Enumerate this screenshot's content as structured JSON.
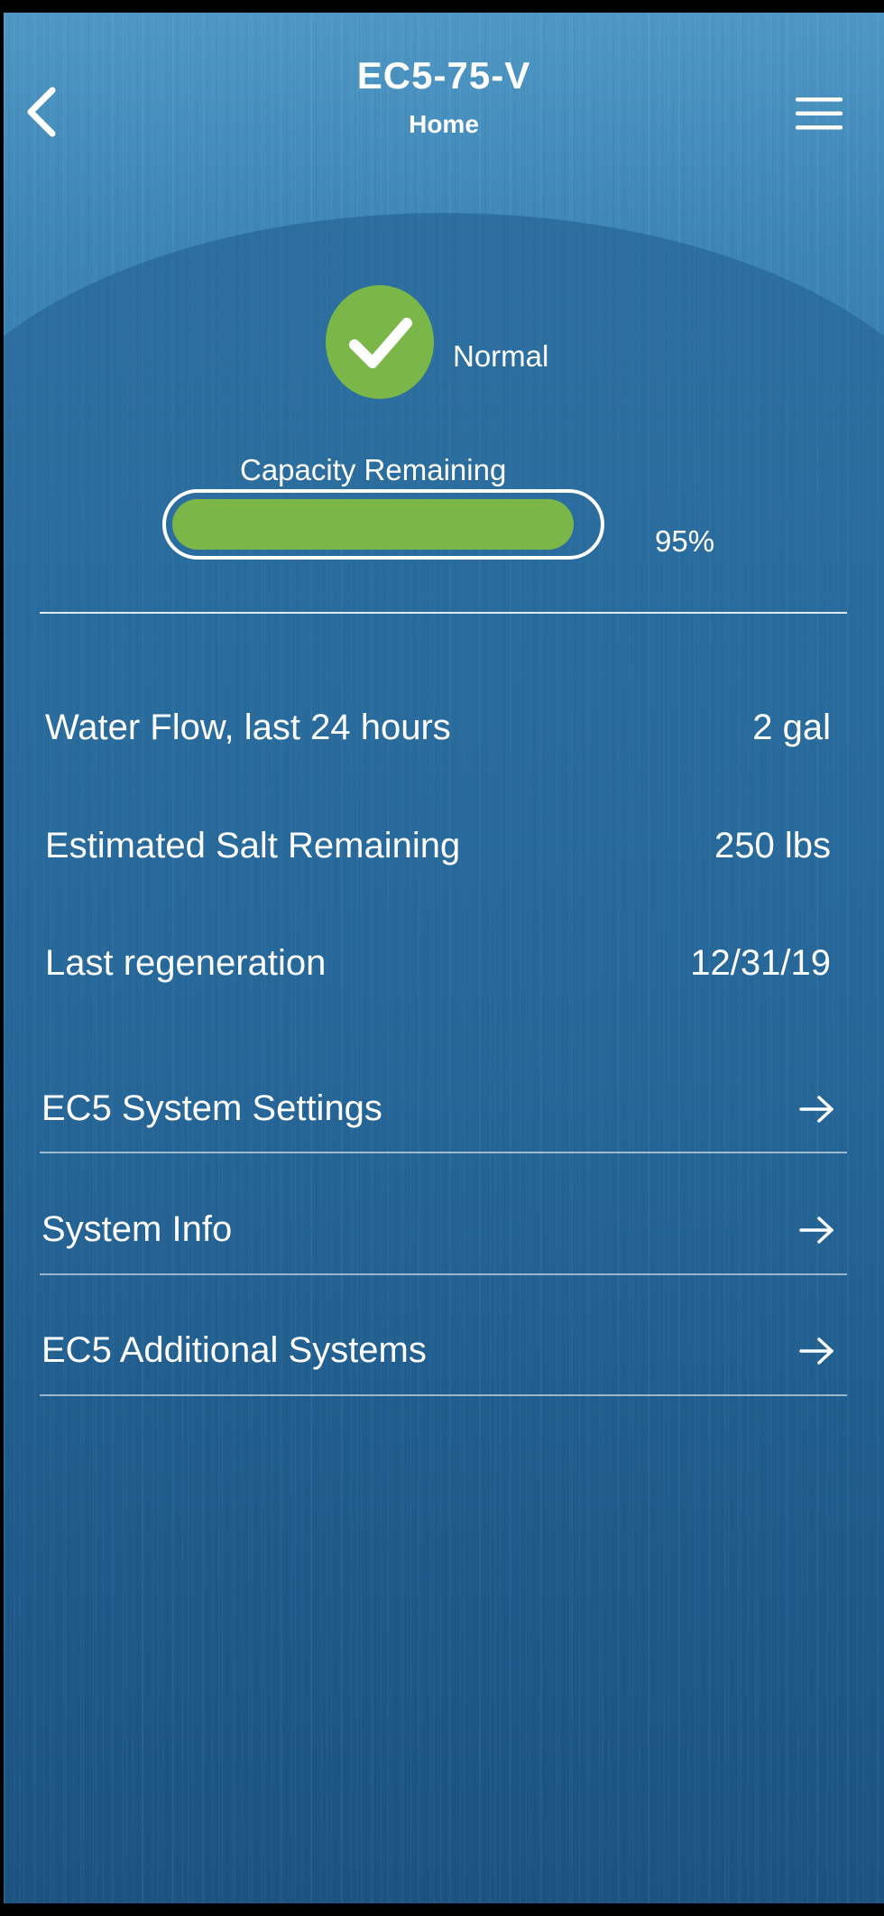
{
  "header": {
    "title": "EC5-75-V",
    "subtitle": "Home",
    "back_icon": "chevron-left-icon",
    "menu_icon": "hamburger-menu-icon"
  },
  "status": {
    "text": "Normal",
    "icon": "checkmark-icon",
    "color": "#7ab648"
  },
  "capacity": {
    "label": "Capacity Remaining",
    "percent_text": "95%",
    "fraction": 0.95,
    "fill_color": "#7ab648"
  },
  "stats": [
    {
      "label": "Water Flow, last 24 hours",
      "value": "2 gal"
    },
    {
      "label": "Estimated Salt Remaining",
      "value": "250 lbs"
    },
    {
      "label": "Last regeneration",
      "value": "12/31/19"
    }
  ],
  "nav": [
    {
      "label": "EC5 System Settings",
      "icon": "arrow-right-icon"
    },
    {
      "label": "System Info",
      "icon": "arrow-right-icon"
    },
    {
      "label": "EC5 Additional Systems",
      "icon": "arrow-right-icon"
    }
  ],
  "colors": {
    "background_top": "#4e97c4",
    "background_bottom": "#1b5382",
    "accent_green": "#7ab648",
    "text": "#ffffff"
  }
}
